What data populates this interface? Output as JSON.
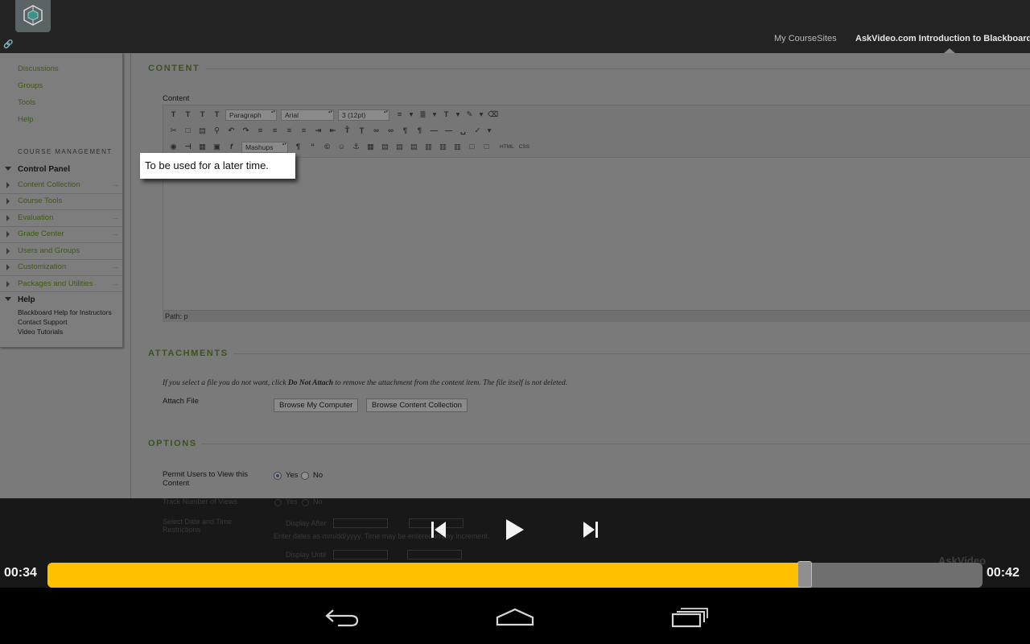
{
  "header": {
    "nav": [
      "My CourseSites",
      "AskVideo.com Introduction to Blackboard"
    ]
  },
  "sidebar": {
    "top_links": [
      "Discussions",
      "Groups",
      "Tools",
      "Help"
    ],
    "course_management_heading": "COURSE MANAGEMENT",
    "control_panel_label": "Control Panel",
    "control_panel_items": [
      "Content Collection",
      "Course Tools",
      "Evaluation",
      "Grade Center",
      "Users and Groups",
      "Customization",
      "Packages and Utilities"
    ],
    "help_title": "Help",
    "help_links": [
      "Blackboard Help for Instructors",
      "Contact Support",
      "Video Tutorials"
    ]
  },
  "content": {
    "section_title": "CONTENT",
    "field_label": "Content",
    "toolbar": {
      "format_select": "Paragraph",
      "font_select": "Arial",
      "size_select": "3 (12pt)",
      "mashups_label": "Mashups",
      "html_label": "HTML",
      "css_label": "CSS"
    },
    "path_label": "Path: p",
    "tooltip": "To be used for a later time."
  },
  "attachments": {
    "section_title": "ATTACHMENTS",
    "note_before": "If you select a file you do not want, click ",
    "note_bold": "Do Not Attach",
    "note_after": " to remove the attachment from the content item. The file itself is not deleted.",
    "attach_label": "Attach File",
    "browse_computer_button": "Browse My Computer",
    "browse_collection_button": "Browse Content Collection"
  },
  "options": {
    "section_title": "OPTIONS",
    "permit_label": "Permit Users to View this Content",
    "yes_label": "Yes",
    "no_label": "No",
    "permit_value": "Yes",
    "track_views_label": "Track Number of Views",
    "date_restrictions_label": "Select Date and Time Restrictions",
    "display_after_label": "Display After",
    "display_until_label": "Display Until",
    "date_hint": "Enter dates as mm/dd/yyyy. Time may be entered in any increment."
  },
  "player": {
    "elapsed": "00:34",
    "total": "00:42",
    "progress_fraction": 0.81,
    "watermark": "AskVideo"
  },
  "colors": {
    "progress_fill": "#ffc000",
    "link_green": "#3c5a14",
    "section_green": "#3b521f"
  },
  "icons": {
    "previous": "skip-previous-icon",
    "play": "play-icon",
    "next": "skip-next-icon",
    "back": "back-arrow-icon",
    "home": "home-icon",
    "recents": "recent-apps-icon"
  }
}
